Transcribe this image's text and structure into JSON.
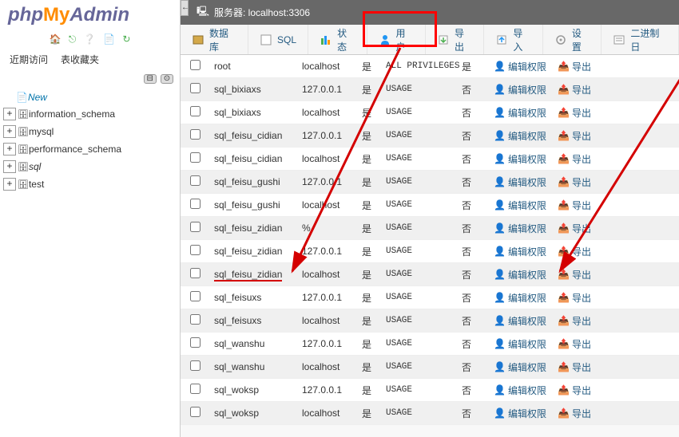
{
  "logo": {
    "php": "php",
    "my": "My",
    "admin": "Admin"
  },
  "sidebar_tabs": {
    "recent": "近期访问",
    "favorites": "表收藏夹"
  },
  "tree": {
    "new_label": "New",
    "items": [
      {
        "label": "information_schema"
      },
      {
        "label": "mysql"
      },
      {
        "label": "performance_schema"
      },
      {
        "label": "sql",
        "selected": true
      },
      {
        "label": "test"
      }
    ]
  },
  "server_label": "服务器: localhost:3306",
  "tabs": [
    {
      "label": "数据库",
      "icon": "db"
    },
    {
      "label": "SQL",
      "icon": "sql"
    },
    {
      "label": "状态",
      "icon": "status"
    },
    {
      "label": "用户",
      "icon": "user",
      "highlighted": true
    },
    {
      "label": "导出",
      "icon": "export"
    },
    {
      "label": "导入",
      "icon": "import"
    },
    {
      "label": "设置",
      "icon": "settings"
    },
    {
      "label": "二进制日",
      "icon": "binlog"
    }
  ],
  "users": [
    {
      "user": "root",
      "host": "localhost",
      "pw": "是",
      "priv": "ALL PRIVILEGES",
      "grant": "是"
    },
    {
      "user": "sql_bixiaxs",
      "host": "127.0.0.1",
      "pw": "是",
      "priv": "USAGE",
      "grant": "否"
    },
    {
      "user": "sql_bixiaxs",
      "host": "localhost",
      "pw": "是",
      "priv": "USAGE",
      "grant": "否"
    },
    {
      "user": "sql_feisu_cidian",
      "host": "127.0.0.1",
      "pw": "是",
      "priv": "USAGE",
      "grant": "否"
    },
    {
      "user": "sql_feisu_cidian",
      "host": "localhost",
      "pw": "是",
      "priv": "USAGE",
      "grant": "否"
    },
    {
      "user": "sql_feisu_gushi",
      "host": "127.0.0.1",
      "pw": "是",
      "priv": "USAGE",
      "grant": "否"
    },
    {
      "user": "sql_feisu_gushi",
      "host": "localhost",
      "pw": "是",
      "priv": "USAGE",
      "grant": "否"
    },
    {
      "user": "sql_feisu_zidian",
      "host": "%",
      "pw": "是",
      "priv": "USAGE",
      "grant": "否"
    },
    {
      "user": "sql_feisu_zidian",
      "host": "127.0.0.1",
      "pw": "是",
      "priv": "USAGE",
      "grant": "否"
    },
    {
      "user": "sql_feisu_zidian",
      "host": "localhost",
      "pw": "是",
      "priv": "USAGE",
      "grant": "否",
      "underlined": true
    },
    {
      "user": "sql_feisuxs",
      "host": "127.0.0.1",
      "pw": "是",
      "priv": "USAGE",
      "grant": "否"
    },
    {
      "user": "sql_feisuxs",
      "host": "localhost",
      "pw": "是",
      "priv": "USAGE",
      "grant": "否"
    },
    {
      "user": "sql_wanshu",
      "host": "127.0.0.1",
      "pw": "是",
      "priv": "USAGE",
      "grant": "否"
    },
    {
      "user": "sql_wanshu",
      "host": "localhost",
      "pw": "是",
      "priv": "USAGE",
      "grant": "否"
    },
    {
      "user": "sql_woksp",
      "host": "127.0.0.1",
      "pw": "是",
      "priv": "USAGE",
      "grant": "否"
    },
    {
      "user": "sql_woksp",
      "host": "localhost",
      "pw": "是",
      "priv": "USAGE",
      "grant": "否"
    }
  ],
  "actions": {
    "edit": "编辑权限",
    "export": "导出"
  }
}
